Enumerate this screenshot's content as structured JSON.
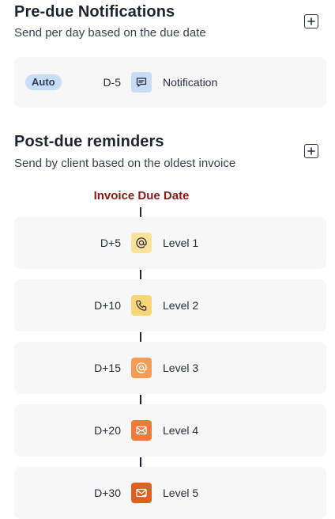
{
  "pre_due": {
    "title": "Pre-due Notifications",
    "subtitle": "Send per day based on the due date",
    "add_icon": "plus-square-icon",
    "item": {
      "badge": "Auto",
      "offset": "D-5",
      "icon": "message-icon",
      "icon_bg": "#c9dcf6",
      "label": "Notification"
    }
  },
  "post_due": {
    "title": "Post-due reminders",
    "subtitle": "Send by client based on the oldest invoice",
    "add_icon": "plus-square-icon",
    "due_label": "Invoice Due Date",
    "due_label_color": "#8b1a12",
    "levels": [
      {
        "offset": "D+5",
        "icon": "at-icon",
        "icon_bg": "#fbe29a",
        "label": "Level 1"
      },
      {
        "offset": "D+10",
        "icon": "phone-icon",
        "icon_bg": "#f8d675",
        "label": "Level 2"
      },
      {
        "offset": "D+15",
        "icon": "at-icon",
        "icon_bg": "#f59d57",
        "label": "Level 3"
      },
      {
        "offset": "D+20",
        "icon": "mail-icon",
        "icon_bg": "#f07a3a",
        "label": "Level 4"
      },
      {
        "offset": "D+30",
        "icon": "mail-send-icon",
        "icon_bg": "#e0601f",
        "label": "Level 5"
      }
    ]
  }
}
